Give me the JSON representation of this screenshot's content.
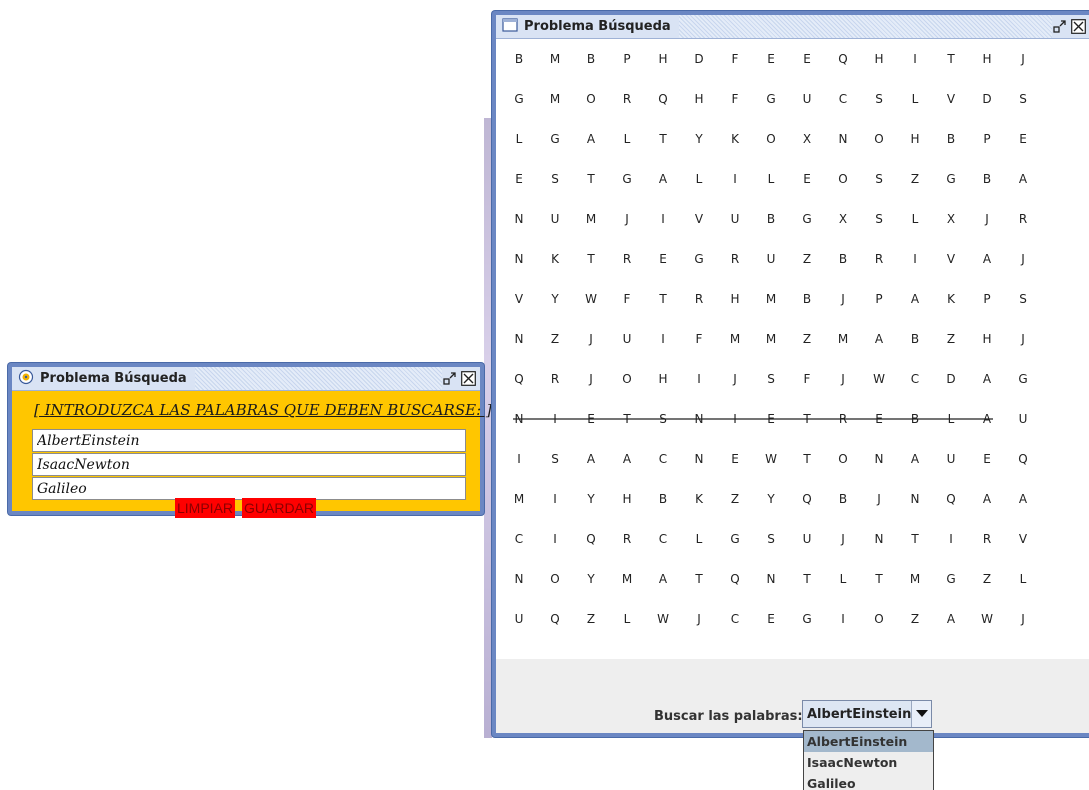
{
  "input_window": {
    "title": "Problema Búsqueda",
    "prompt": "[ INTRODUZCA LAS PALABRAS QUE DEBEN BUSCARSE: ]",
    "fields": [
      "AlbertEinstein",
      "IsaacNewton",
      "Galileo"
    ],
    "clear_label": "LIMPIAR",
    "save_label": "GUARDAR",
    "background_color": "#ffc600",
    "button_color": "#ff0000"
  },
  "grid_window": {
    "title": "Problema Búsqueda",
    "rows": [
      [
        "B",
        "M",
        "B",
        "P",
        "H",
        "D",
        "F",
        "E",
        "E",
        "Q",
        "H",
        "I",
        "T",
        "H",
        "J"
      ],
      [
        "G",
        "M",
        "O",
        "R",
        "Q",
        "H",
        "F",
        "G",
        "U",
        "C",
        "S",
        "L",
        "V",
        "D",
        "S"
      ],
      [
        "L",
        "G",
        "A",
        "L",
        "T",
        "Y",
        "K",
        "O",
        "X",
        "N",
        "O",
        "H",
        "B",
        "P",
        "E"
      ],
      [
        "E",
        "S",
        "T",
        "G",
        "A",
        "L",
        "I",
        "L",
        "E",
        "O",
        "S",
        "Z",
        "G",
        "B",
        "A"
      ],
      [
        "N",
        "U",
        "M",
        "J",
        "I",
        "V",
        "U",
        "B",
        "G",
        "X",
        "S",
        "L",
        "X",
        "J",
        "R"
      ],
      [
        "N",
        "K",
        "T",
        "R",
        "E",
        "G",
        "R",
        "U",
        "Z",
        "B",
        "R",
        "I",
        "V",
        "A",
        "J"
      ],
      [
        "V",
        "Y",
        "W",
        "F",
        "T",
        "R",
        "H",
        "M",
        "B",
        "J",
        "P",
        "A",
        "K",
        "P",
        "S"
      ],
      [
        "N",
        "Z",
        "J",
        "U",
        "I",
        "F",
        "M",
        "M",
        "Z",
        "M",
        "A",
        "B",
        "Z",
        "H",
        "J"
      ],
      [
        "Q",
        "R",
        "J",
        "O",
        "H",
        "I",
        "J",
        "S",
        "F",
        "J",
        "W",
        "C",
        "D",
        "A",
        "G"
      ],
      [
        "N",
        "I",
        "E",
        "T",
        "S",
        "N",
        "I",
        "E",
        "T",
        "R",
        "E",
        "B",
        "L",
        "A",
        "U"
      ],
      [
        "I",
        "S",
        "A",
        "A",
        "C",
        "N",
        "E",
        "W",
        "T",
        "O",
        "N",
        "A",
        "U",
        "E",
        "Q"
      ],
      [
        "M",
        "I",
        "Y",
        "H",
        "B",
        "K",
        "Z",
        "Y",
        "Q",
        "B",
        "J",
        "N",
        "Q",
        "A",
        "A"
      ],
      [
        "C",
        "I",
        "Q",
        "R",
        "C",
        "L",
        "G",
        "S",
        "U",
        "J",
        "N",
        "T",
        "I",
        "R",
        "V"
      ],
      [
        "N",
        "O",
        "Y",
        "M",
        "A",
        "T",
        "Q",
        "N",
        "T",
        "L",
        "T",
        "M",
        "G",
        "Z",
        "L"
      ],
      [
        "U",
        "Q",
        "Z",
        "L",
        "W",
        "J",
        "C",
        "E",
        "G",
        "I",
        "O",
        "Z",
        "A",
        "W",
        "J"
      ]
    ],
    "found_word": {
      "row": 9,
      "col_start": 0,
      "col_end": 13
    },
    "search_label": "Buscar las palabras:",
    "selected_word": "AlbertEinstein",
    "options": [
      "AlbertEinstein",
      "IsaacNewton",
      "Galileo"
    ]
  }
}
